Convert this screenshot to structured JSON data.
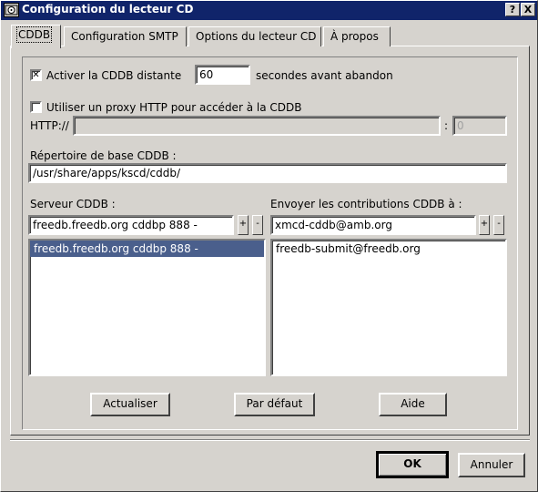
{
  "window": {
    "title": "Configuration du lecteur CD",
    "help_btn": "?",
    "close_btn": "X"
  },
  "tabs": [
    {
      "label": "CDDB",
      "active": true
    },
    {
      "label": "Configuration SMTP",
      "active": false
    },
    {
      "label": "Options du lecteur CD",
      "active": false
    },
    {
      "label": "À propos",
      "active": false
    }
  ],
  "cddb": {
    "remote": {
      "checked": true,
      "check_mark": "✕",
      "label": "Activer la CDDB distante",
      "timeout_value": "60",
      "timeout_suffix": "secondes avant abandon"
    },
    "proxy": {
      "checked": false,
      "label": "Utiliser un proxy HTTP pour accéder à la CDDB",
      "http_label": "HTTP://",
      "host_value": "",
      "port_sep": ":",
      "port_value": "0"
    },
    "basedir": {
      "label": "Répertoire de base CDDB :",
      "value": "/usr/share/apps/kscd/cddb/"
    },
    "server": {
      "label": "Serveur CDDB :",
      "input_value": "freedb.freedb.org cddbp 888 -",
      "add": "+",
      "remove": "-",
      "items": [
        "freedb.freedb.org cddbp 888 -"
      ]
    },
    "submit": {
      "label": "Envoyer les contributions CDDB à :",
      "input_value": "xmcd-cddb@amb.org",
      "add": "+",
      "remove": "-",
      "items": [
        "freedb-submit@freedb.org"
      ]
    },
    "buttons": {
      "refresh": "Actualiser",
      "defaults": "Par défaut",
      "help": "Aide"
    }
  },
  "dialog": {
    "ok": "OK",
    "cancel": "Annuler"
  },
  "colors": {
    "titlebar": "#10246a",
    "selection": "#4a5f8c",
    "face": "#d6d3ce"
  }
}
